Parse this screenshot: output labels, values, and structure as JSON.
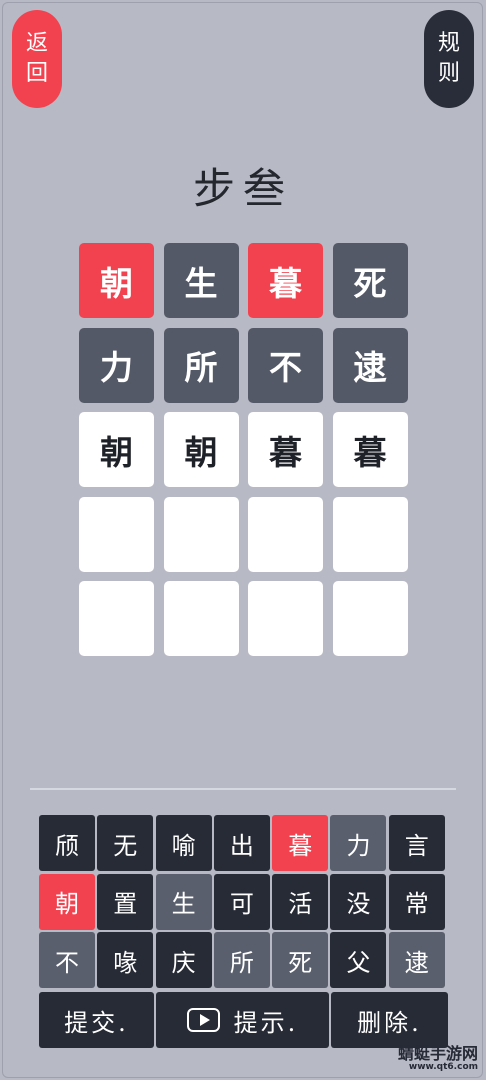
{
  "header": {
    "back_chars": [
      "返",
      "回"
    ],
    "rules_chars": [
      "规",
      "则"
    ]
  },
  "title": "步叁",
  "board": {
    "rows": [
      [
        {
          "char": "朝",
          "state": "red"
        },
        {
          "char": "生",
          "state": "gray"
        },
        {
          "char": "暮",
          "state": "red"
        },
        {
          "char": "死",
          "state": "gray"
        }
      ],
      [
        {
          "char": "力",
          "state": "gray"
        },
        {
          "char": "所",
          "state": "gray"
        },
        {
          "char": "不",
          "state": "gray"
        },
        {
          "char": "逮",
          "state": "gray"
        }
      ],
      [
        {
          "char": "朝",
          "state": "white"
        },
        {
          "char": "朝",
          "state": "white"
        },
        {
          "char": "暮",
          "state": "white"
        },
        {
          "char": "暮",
          "state": "white"
        }
      ],
      [
        {
          "char": "",
          "state": "empty"
        },
        {
          "char": "",
          "state": "empty"
        },
        {
          "char": "",
          "state": "empty"
        },
        {
          "char": "",
          "state": "empty"
        }
      ],
      [
        {
          "char": "",
          "state": "empty"
        },
        {
          "char": "",
          "state": "empty"
        },
        {
          "char": "",
          "state": "empty"
        },
        {
          "char": "",
          "state": "empty"
        }
      ]
    ]
  },
  "keyboard": {
    "rows": [
      [
        {
          "char": "颀",
          "state": "dark"
        },
        {
          "char": "无",
          "state": "dark"
        },
        {
          "char": "喻",
          "state": "dark"
        },
        {
          "char": "出",
          "state": "dark"
        },
        {
          "char": "暮",
          "state": "red"
        },
        {
          "char": "力",
          "state": "gray"
        },
        {
          "char": "言",
          "state": "dark"
        }
      ],
      [
        {
          "char": "朝",
          "state": "red"
        },
        {
          "char": "置",
          "state": "dark"
        },
        {
          "char": "生",
          "state": "gray"
        },
        {
          "char": "可",
          "state": "dark"
        },
        {
          "char": "活",
          "state": "dark"
        },
        {
          "char": "没",
          "state": "dark"
        },
        {
          "char": "常",
          "state": "dark"
        }
      ],
      [
        {
          "char": "不",
          "state": "gray"
        },
        {
          "char": "喙",
          "state": "dark"
        },
        {
          "char": "庆",
          "state": "dark"
        },
        {
          "char": "所",
          "state": "gray"
        },
        {
          "char": "死",
          "state": "gray"
        },
        {
          "char": "父",
          "state": "dark"
        },
        {
          "char": "逮",
          "state": "gray"
        }
      ]
    ],
    "submit_label": "提交.",
    "hint_label": "提示.",
    "hint_icon": "video-play-icon",
    "delete_label": "删除."
  },
  "colors": {
    "background": "#b7b9c4",
    "accent_red": "#f2424f",
    "tile_gray": "#545968",
    "key_dark": "#272b36"
  },
  "watermark": {
    "name": "蜻蜓手游网",
    "url": "www.qt6.com"
  }
}
